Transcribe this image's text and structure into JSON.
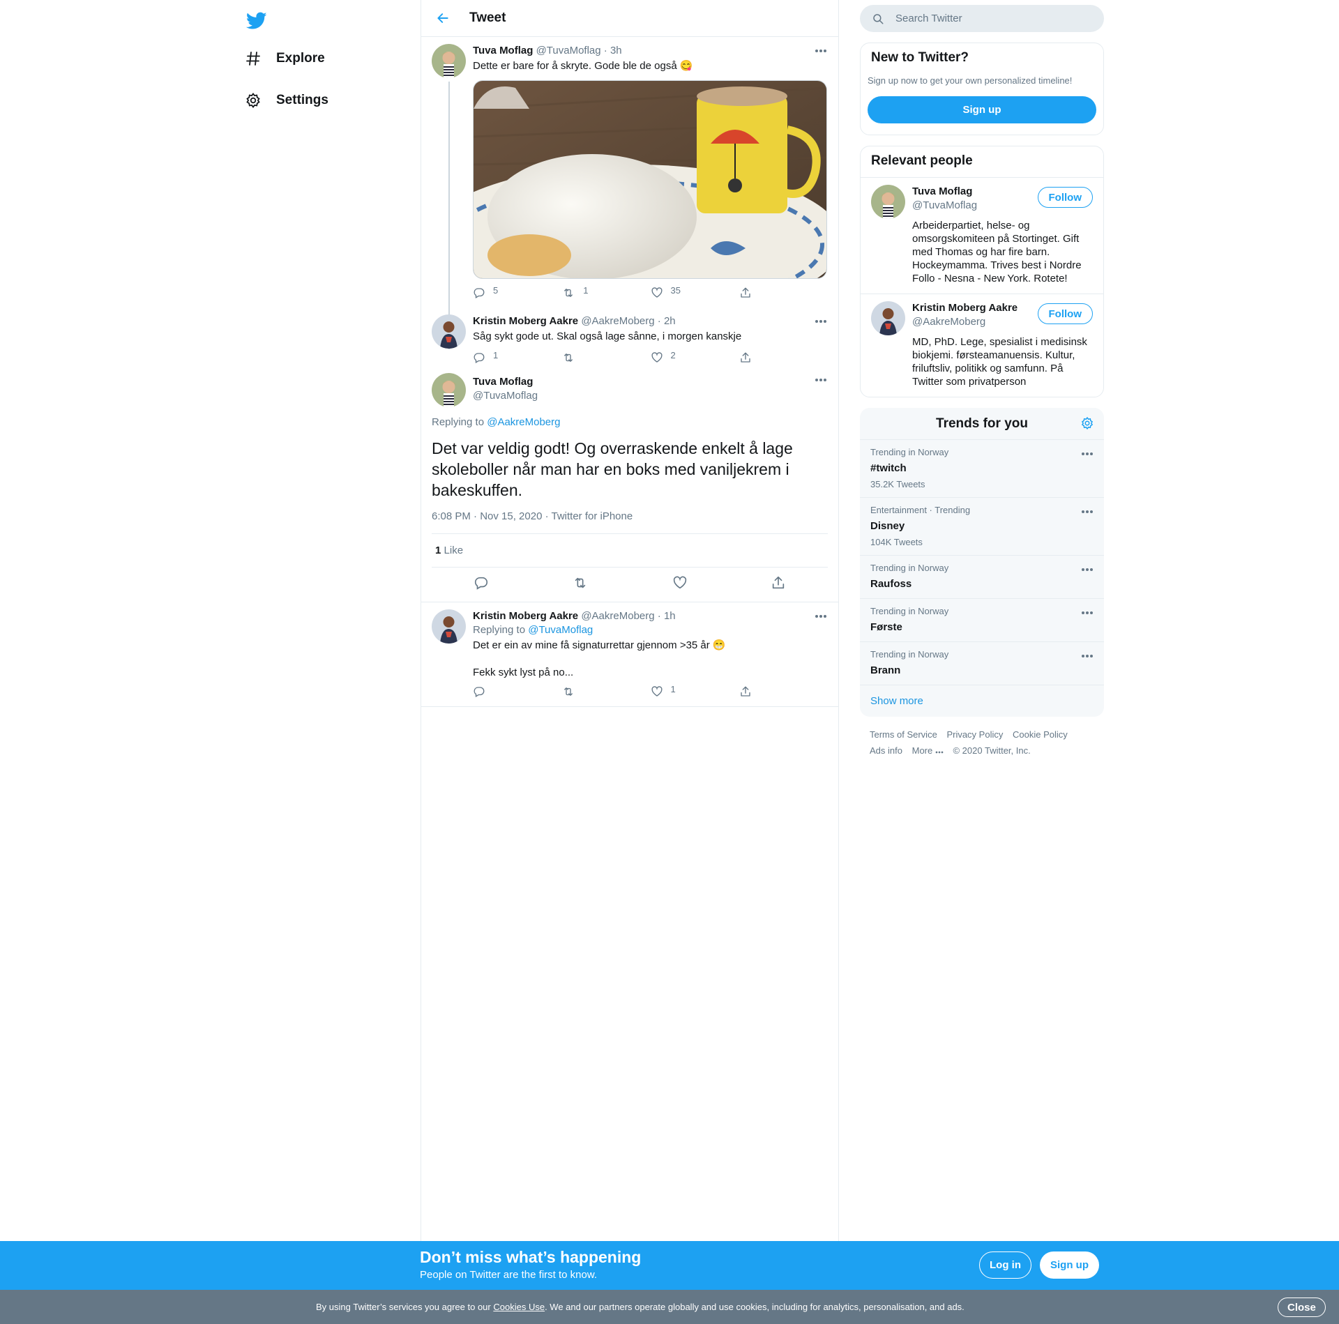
{
  "nav": {
    "items": [
      {
        "label": "Explore"
      },
      {
        "label": "Settings"
      }
    ]
  },
  "header": {
    "title": "Tweet"
  },
  "thread": [
    {
      "name": "Tuva Moflag",
      "handle": "@TuvaMoflag",
      "time": "· 3h",
      "text": "Dette er bare for å skryte. Gode ble de også 😋",
      "replies": "5",
      "retweets": "1",
      "likes": "35"
    },
    {
      "name": "Kristin Moberg Aakre",
      "handle": "@AakreMoberg",
      "time": "· 2h",
      "text": "Såg sykt gode ut. Skal også lage sånne, i morgen kanskje",
      "replies": "1",
      "retweets": "",
      "likes": "2"
    }
  ],
  "focus": {
    "name": "Tuva Moflag",
    "handle": "@TuvaMoflag",
    "replying_prefix": "Replying to",
    "replying_to": "@AakreMoberg",
    "text": "Det var veldig godt! Og overraskende enkelt å lage skoleboller når man har en boks med vaniljekrem i bakeskuffen.",
    "meta": "6:08 PM · Nov 15, 2020 · Twitter for iPhone",
    "like_count": "1",
    "like_label": "Like"
  },
  "reply": {
    "name": "Kristin Moberg Aakre",
    "handle": "@AakreMoberg",
    "time": "· 1h",
    "replying_prefix": "Replying to",
    "replying_to": "@TuvaMoflag",
    "text1": "Det er ein av mine få signaturrettar gjennom >35 år 😁",
    "text2": "Fekk sykt lyst på no...",
    "replies": "",
    "retweets": "",
    "likes": "1"
  },
  "search": {
    "placeholder": "Search Twitter"
  },
  "signup_card": {
    "title": "New to Twitter?",
    "subtitle": "Sign up now to get your own personalized timeline!",
    "button": "Sign up"
  },
  "relevant": {
    "title": "Relevant people",
    "people": [
      {
        "name": "Tuva Moflag",
        "handle": "@TuvaMoflag",
        "follow": "Follow",
        "bio": "Arbeiderpartiet, helse- og omsorgskomiteen på Stortinget. Gift med Thomas og har fire barn. Hockeymamma. Trives best i Nordre Follo - Nesna - New York. Rotete!"
      },
      {
        "name": "Kristin Moberg Aakre",
        "handle": "@AakreMoberg",
        "follow": "Follow",
        "bio": "MD, PhD. Lege, spesialist i medisinsk biokjemi. førsteamanuensis. Kultur, friluftsliv, politikk og samfunn. På Twitter som privatperson"
      }
    ]
  },
  "trends": {
    "title": "Trends for you",
    "items": [
      {
        "context": "Trending in Norway",
        "topic": "#twitch",
        "count": "35.2K Tweets"
      },
      {
        "context": "Entertainment · Trending",
        "topic": "Disney",
        "count": "104K Tweets"
      },
      {
        "context": "Trending in Norway",
        "topic": "Raufoss",
        "count": ""
      },
      {
        "context": "Trending in Norway",
        "topic": "Første",
        "count": ""
      },
      {
        "context": "Trending in Norway",
        "topic": "Brann",
        "count": ""
      }
    ],
    "show_more": "Show more"
  },
  "footer": {
    "terms": "Terms of Service",
    "privacy": "Privacy Policy",
    "cookie": "Cookie Policy",
    "ads": "Ads info",
    "more": "More",
    "copyright": "© 2020 Twitter, Inc."
  },
  "banner": {
    "title": "Don’t miss what’s happening",
    "subtitle": "People on Twitter are the first to know.",
    "login": "Log in",
    "signup": "Sign up"
  },
  "cookie_bar": {
    "prefix": "By using Twitter’s services you agree to our ",
    "link": "Cookies Use",
    "suffix": ". We and our partners operate globally and use cookies, including for analytics, personalisation, and ads.",
    "close": "Close"
  },
  "colors": {
    "accent": "#1da1f2",
    "link": "#1b95e0",
    "secondary_text": "#657786",
    "border": "#e6ecf0",
    "cookie_bar": "#657786"
  },
  "icons": [
    "twitter-logo-icon",
    "hashtag-icon",
    "gear-icon",
    "back-arrow-icon",
    "search-icon",
    "more-icon",
    "reply-icon",
    "retweet-icon",
    "like-icon",
    "share-icon"
  ]
}
